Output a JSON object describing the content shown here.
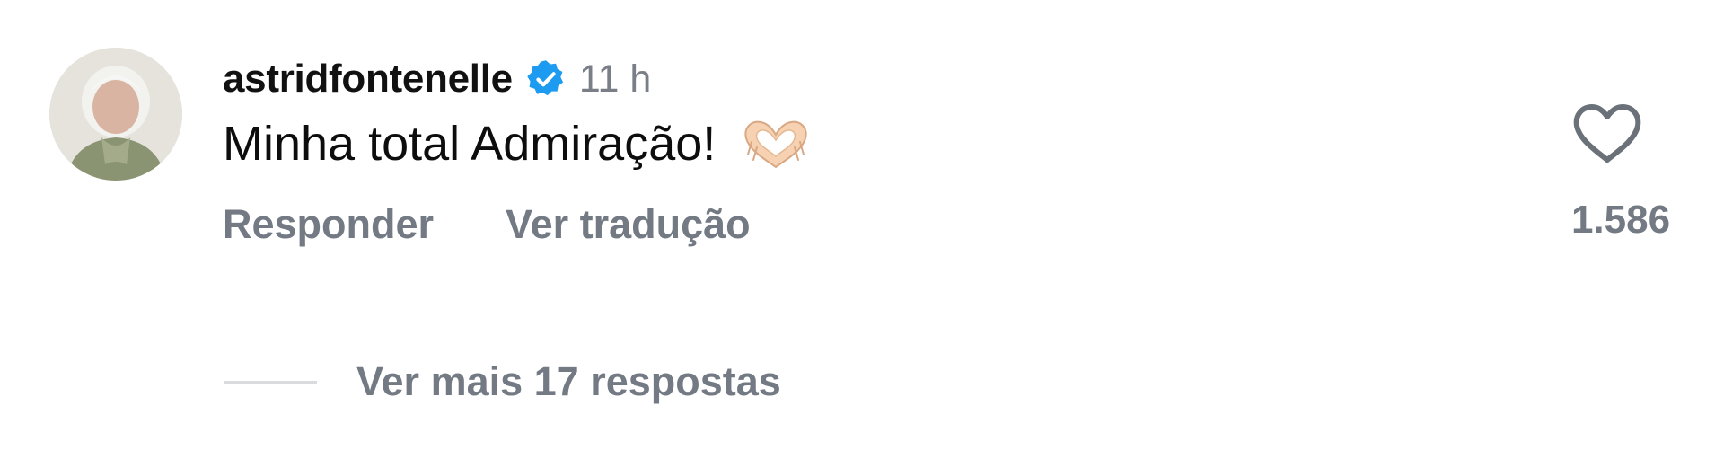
{
  "comment": {
    "username": "astridfontenelle",
    "verified": true,
    "timestamp": "11 h",
    "text": "Minha total Admiração!",
    "emoji": "heart-hands-emoji",
    "actions": {
      "reply_label": "Responder",
      "translate_label": "Ver tradução"
    },
    "more_replies_label": "Ver mais 17 respostas",
    "likes": "1.586"
  },
  "colors": {
    "verified_badge": "#1d9bf0",
    "secondary_text": "#737a83",
    "primary_text": "#111111"
  }
}
